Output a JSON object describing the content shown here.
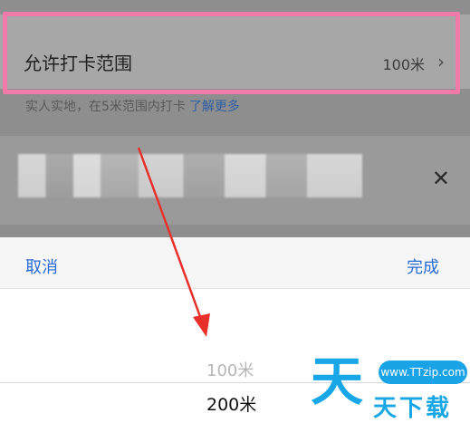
{
  "setting": {
    "title": "允许打卡范围",
    "value": "100米"
  },
  "hint": {
    "text": "实人实地，在5米范围内打卡",
    "link": "了解更多"
  },
  "picker": {
    "cancel": "取消",
    "done": "完成",
    "options": [
      "100米",
      "200米"
    ],
    "selected": "200米"
  },
  "watermark": {
    "url": "www.TTzip.com",
    "logo_char": "天",
    "name": "天下载"
  },
  "colors": {
    "accent": "#2a6bd6",
    "highlight": "#f07aa8",
    "arrow": "#e8302a",
    "watermark": "#18a7e6"
  },
  "icons": {
    "chevron": "chevron-right-icon",
    "close": "close-icon"
  }
}
